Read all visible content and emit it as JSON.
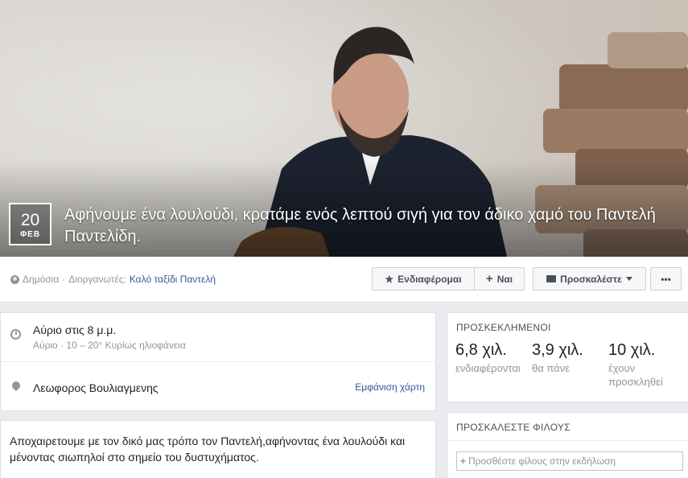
{
  "cover": {
    "date_day": "20",
    "date_month": "ΦΕΒ",
    "title": "Αφήνουμε ένα λουλούδι, κρατάμε ενός λεπτού σιγή για τον άδικο χαμό του Παντελή Παντελίδη."
  },
  "meta": {
    "privacy": "Δημόσια",
    "separator": "·",
    "organizers_label": "Διοργανωτές:",
    "host": "Καλό ταξίδι Παντελή"
  },
  "actions": {
    "interested_icon": "star-icon",
    "interested_label": "Ενδιαφέρομαι",
    "going_icon": "plus-icon",
    "going_label": "Ναι",
    "invite_icon": "envelope-icon",
    "invite_label": "Προσκαλέστε",
    "more_label": "•••"
  },
  "details": {
    "time_main": "Αύριο στις 8 μ.μ.",
    "time_sub": "Αύριο · 10 – 20° Κυρίως ηλιοφάνεια",
    "location": "Λεωφορος Βουλιαγμενης",
    "map_link": "Εμφάνιση χάρτη",
    "description": "Αποχαιρετουμε με τον δικό μας τρόπο τον Παντελή,αφήνοντας ένα λουλούδι και μένοντας σιωπηλοί στο σημείο του δυστυχήματος."
  },
  "guests": {
    "title": "ΠΡΟΣΚΕΚΛΗΜΕΝΟΙ",
    "stats": [
      {
        "value": "6,8 χιλ.",
        "label": "ενδιαφέρονται"
      },
      {
        "value": "3,9 χιλ.",
        "label": "θα πάνε"
      },
      {
        "value": "10 χιλ.",
        "label": "έχουν προσκληθεί"
      }
    ]
  },
  "invite_friends": {
    "title": "ΠΡΟΣΚΑΛΕΣΤΕ ΦΙΛΟΥΣ",
    "placeholder": "Προσθέστε φίλους στην εκδήλωση"
  }
}
